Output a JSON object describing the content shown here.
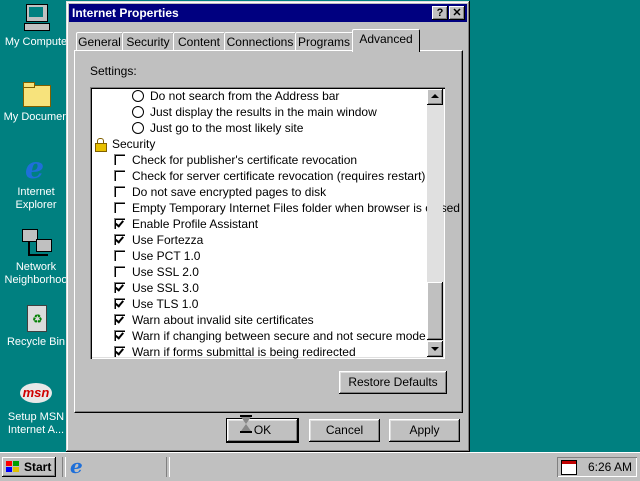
{
  "desktop": {
    "icons": [
      {
        "label": "My Compute",
        "icon": "my-computer-icon"
      },
      {
        "label": "My Documen",
        "icon": "folder-icon"
      },
      {
        "label": "Internet",
        "label2": "Explorer",
        "icon": "internet-explorer-icon"
      },
      {
        "label": "Network",
        "label2": "Neighborhoo",
        "icon": "network-icon"
      },
      {
        "label": "Recycle Bin",
        "icon": "recycle-bin-icon"
      },
      {
        "label": "Setup MSN",
        "label2": "Internet A...",
        "icon": "msn-icon"
      }
    ]
  },
  "dialog": {
    "title": "Internet Properties",
    "help_btn": "?",
    "close_btn": "✕",
    "tabs": [
      "General",
      "Security",
      "Content",
      "Connections",
      "Programs",
      "Advanced"
    ],
    "active_tab": "Advanced",
    "settings_label": "Settings:",
    "radios": [
      {
        "label": "Do not search from the Address bar",
        "checked": false
      },
      {
        "label": "Just display the results in the main window",
        "checked": false
      },
      {
        "label": "Just go to the most likely site",
        "checked": false
      }
    ],
    "security_group": "Security",
    "checks": [
      {
        "label": "Check for publisher's certificate revocation",
        "checked": false
      },
      {
        "label": "Check for server certificate revocation (requires restart)",
        "checked": false
      },
      {
        "label": "Do not save encrypted pages to disk",
        "checked": false
      },
      {
        "label": "Empty Temporary Internet Files folder when browser is closed",
        "checked": false
      },
      {
        "label": "Enable Profile Assistant",
        "checked": true
      },
      {
        "label": "Use Fortezza",
        "checked": true
      },
      {
        "label": "Use PCT 1.0",
        "checked": false
      },
      {
        "label": "Use SSL 2.0",
        "checked": false
      },
      {
        "label": "Use SSL 3.0",
        "checked": true
      },
      {
        "label": "Use TLS 1.0",
        "checked": true
      },
      {
        "label": "Warn about invalid site certificates",
        "checked": true
      },
      {
        "label": "Warn if changing between secure and not secure mode",
        "checked": true
      },
      {
        "label": "Warn if forms submittal is being redirected",
        "checked": true
      }
    ],
    "restore_defaults": "Restore Defaults",
    "ok": "OK",
    "cancel": "Cancel",
    "apply": "Apply"
  },
  "taskbar": {
    "start": "Start",
    "clock": "6:26 AM"
  }
}
